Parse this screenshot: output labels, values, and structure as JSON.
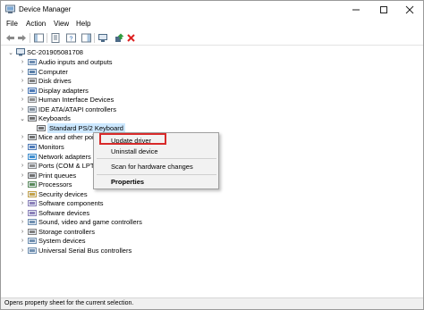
{
  "window": {
    "title": "Device Manager"
  },
  "menu": [
    "File",
    "Action",
    "View",
    "Help"
  ],
  "tree": {
    "root": "SC-201905081708",
    "categories": [
      {
        "label": "Audio inputs and outputs",
        "expanded": false
      },
      {
        "label": "Computer",
        "expanded": false
      },
      {
        "label": "Disk drives",
        "expanded": false
      },
      {
        "label": "Display adapters",
        "expanded": false
      },
      {
        "label": "Human Interface Devices",
        "expanded": false
      },
      {
        "label": "IDE ATA/ATAPI controllers",
        "expanded": false
      },
      {
        "label": "Keyboards",
        "expanded": true
      },
      {
        "label": "Standard PS/2 Keyboard",
        "child": true,
        "selected": true
      },
      {
        "label": "Mice and other poi",
        "expanded": false
      },
      {
        "label": "Monitors",
        "expanded": false
      },
      {
        "label": "Network adapters",
        "expanded": false
      },
      {
        "label": "Ports (COM & LPT)",
        "expanded": false
      },
      {
        "label": "Print queues",
        "expanded": false
      },
      {
        "label": "Processors",
        "expanded": false
      },
      {
        "label": "Security devices",
        "expanded": false
      },
      {
        "label": "Software components",
        "expanded": false
      },
      {
        "label": "Software devices",
        "expanded": false
      },
      {
        "label": "Sound, video and game controllers",
        "expanded": false
      },
      {
        "label": "Storage controllers",
        "expanded": false
      },
      {
        "label": "System devices",
        "expanded": false
      },
      {
        "label": "Universal Serial Bus controllers",
        "expanded": false
      }
    ]
  },
  "context_menu": {
    "update_driver": "Update driver",
    "uninstall_device": "Uninstall device",
    "scan": "Scan for hardware changes",
    "properties": "Properties"
  },
  "status_bar": "Opens property sheet for the current selection.",
  "colors": {
    "highlight": "#d82a2a",
    "selection": "#cce8ff"
  }
}
